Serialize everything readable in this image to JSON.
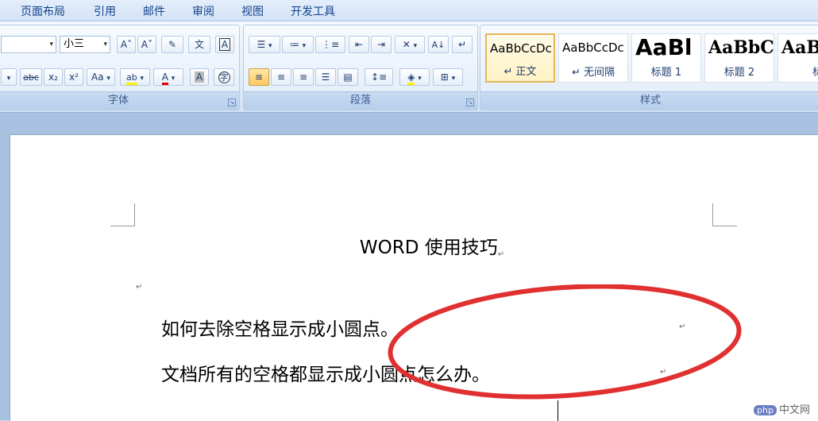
{
  "menu": [
    "页面布局",
    "引用",
    "邮件",
    "审阅",
    "视图",
    "开发工具"
  ],
  "font_group": {
    "label": "字体",
    "font_size": "小三",
    "buttons": [
      "A˄",
      "A˅",
      "abc",
      "x₂",
      "x²",
      "Aa",
      "ab",
      "A",
      "A",
      "字"
    ]
  },
  "paragraph_group": {
    "label": "段落"
  },
  "styles_group": {
    "label": "样式",
    "tiles": [
      {
        "sample": "AaBbCcDc",
        "name": "↵ 正文"
      },
      {
        "sample": "AaBbCcDc",
        "name": "↵ 无间隔"
      },
      {
        "sample": "AaBl",
        "name": "标题 1"
      },
      {
        "sample": "AaBbC",
        "name": "标题 2"
      },
      {
        "sample": "AaB",
        "name": "标"
      }
    ]
  },
  "document": {
    "title": "WORD 使用技巧",
    "paragraphs": [
      "如何去除空格显示成小圆点。",
      "文档所有的空格都显示成小圆点怎么办。"
    ],
    "para_mark": "↵"
  },
  "watermark": {
    "logo": "php",
    "text": "中文网"
  },
  "colors": {
    "annotation_ellipse": "#e03030",
    "accent": "#15428b"
  }
}
